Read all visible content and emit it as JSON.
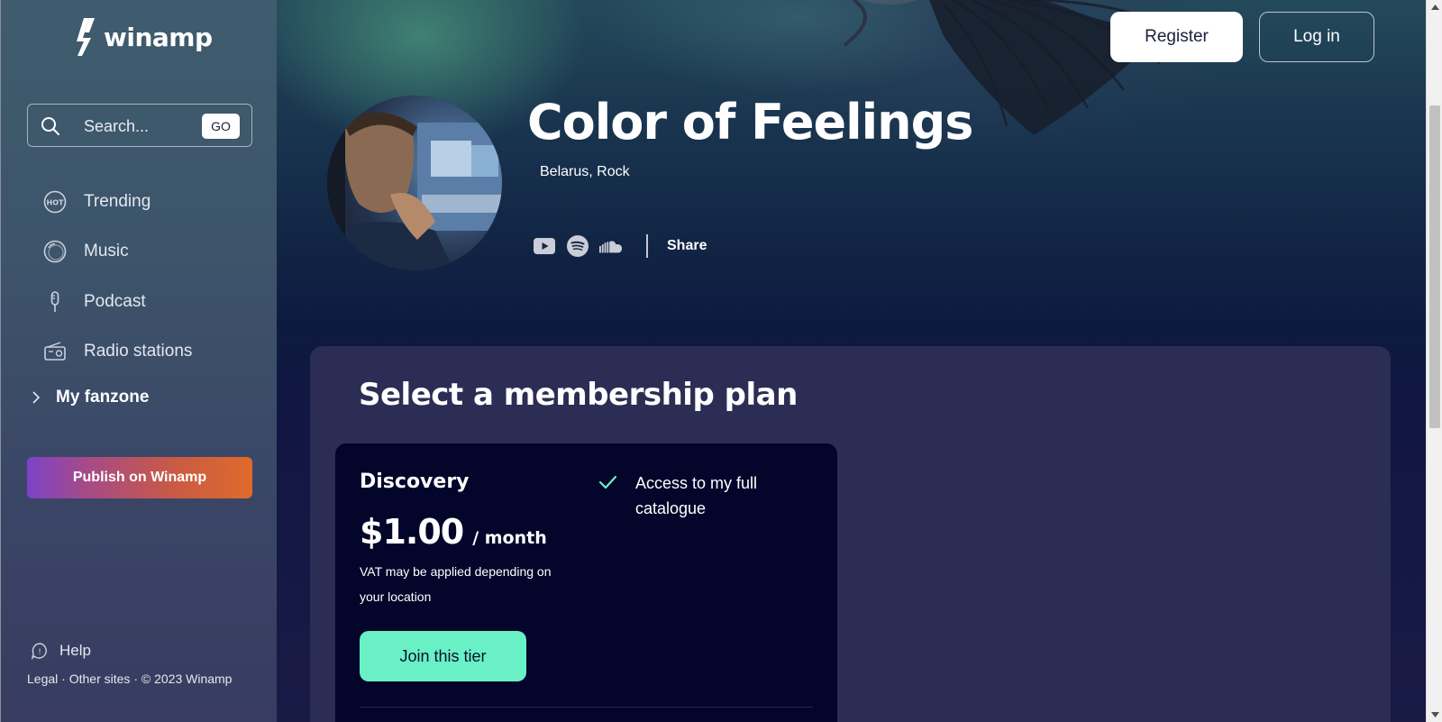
{
  "brand": {
    "name": "winamp"
  },
  "search": {
    "placeholder": "Search...",
    "go_label": "GO"
  },
  "nav": {
    "items": [
      {
        "label": "Trending",
        "icon": "hot-icon"
      },
      {
        "label": "Music",
        "icon": "disc-icon"
      },
      {
        "label": "Podcast",
        "icon": "microphone-icon"
      },
      {
        "label": "Radio stations",
        "icon": "radio-icon"
      }
    ],
    "fanzone_label": "My fanzone"
  },
  "publish_label": "Publish on Winamp",
  "help_label": "Help",
  "footer": {
    "legal": "Legal",
    "other_sites": "Other sites",
    "copyright": "© 2023 Winamp",
    "separator": "·"
  },
  "header": {
    "register_label": "Register",
    "login_label": "Log in"
  },
  "artist": {
    "name": "Color of Feelings",
    "meta": "Belarus, Rock",
    "share_label": "Share",
    "socials": [
      "youtube-icon",
      "spotify-icon",
      "soundcloud-icon"
    ]
  },
  "membership": {
    "title": "Select a membership plan",
    "tier": {
      "name": "Discovery",
      "price": "$1.00",
      "period": "/ month",
      "vat_note": "VAT may be applied depending on your location",
      "join_label": "Join this tier",
      "perks": [
        "Access to my full catalogue"
      ]
    }
  },
  "colors": {
    "accent": "#6af0c5",
    "sidebar_top": "#3f5c6e",
    "panel": "#2b2d55",
    "card": "#03052a",
    "publish_gradient": [
      "#7b43c8",
      "#e06a2a"
    ]
  }
}
